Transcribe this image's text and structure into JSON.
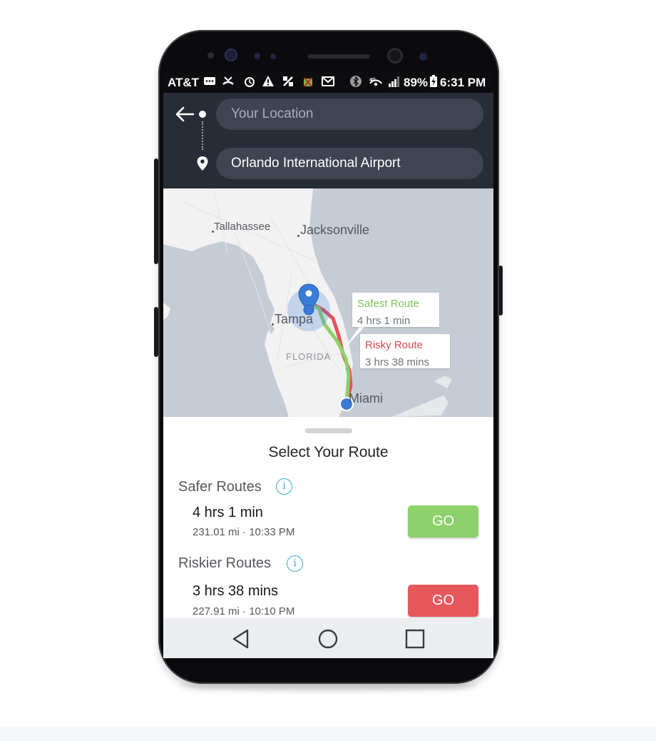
{
  "status_bar": {
    "carrier": "AT&T",
    "battery": "89%",
    "time": "6:31 PM"
  },
  "route": {
    "origin_placeholder": "Your Location",
    "destination": "Orlando International Airport"
  },
  "map": {
    "cities": [
      "Tallahassee",
      "Jacksonville",
      "Tampa",
      "Miami"
    ],
    "region_label": "FLORIDA",
    "callouts": {
      "safest": {
        "title": "Safest Route",
        "time": "4 hrs 1 min"
      },
      "risky": {
        "title": "Risky Route",
        "time": "3 hrs 38 mins"
      }
    },
    "colors": {
      "safe_route": "#8dd16a",
      "risky_route": "#e2525a",
      "pin": "#3b7bd8",
      "water": "#c5ccd6",
      "land": "#f2f2f2"
    }
  },
  "sheet": {
    "title": "Select Your Route",
    "safer": {
      "heading": "Safer Routes",
      "info_glyph": "i",
      "duration": "4 hrs 1 min",
      "details": "231.01 mi · 10:33 PM",
      "go_label": "GO"
    },
    "riskier": {
      "heading": "Riskier Routes",
      "info_glyph": "i",
      "duration": "3 hrs 38 mins",
      "details": "227.91 mi · 10:10 PM",
      "go_label": "GO"
    }
  },
  "navbar": {
    "icons": [
      "back-triangle-icon",
      "home-circle-icon",
      "recents-square-icon"
    ]
  }
}
